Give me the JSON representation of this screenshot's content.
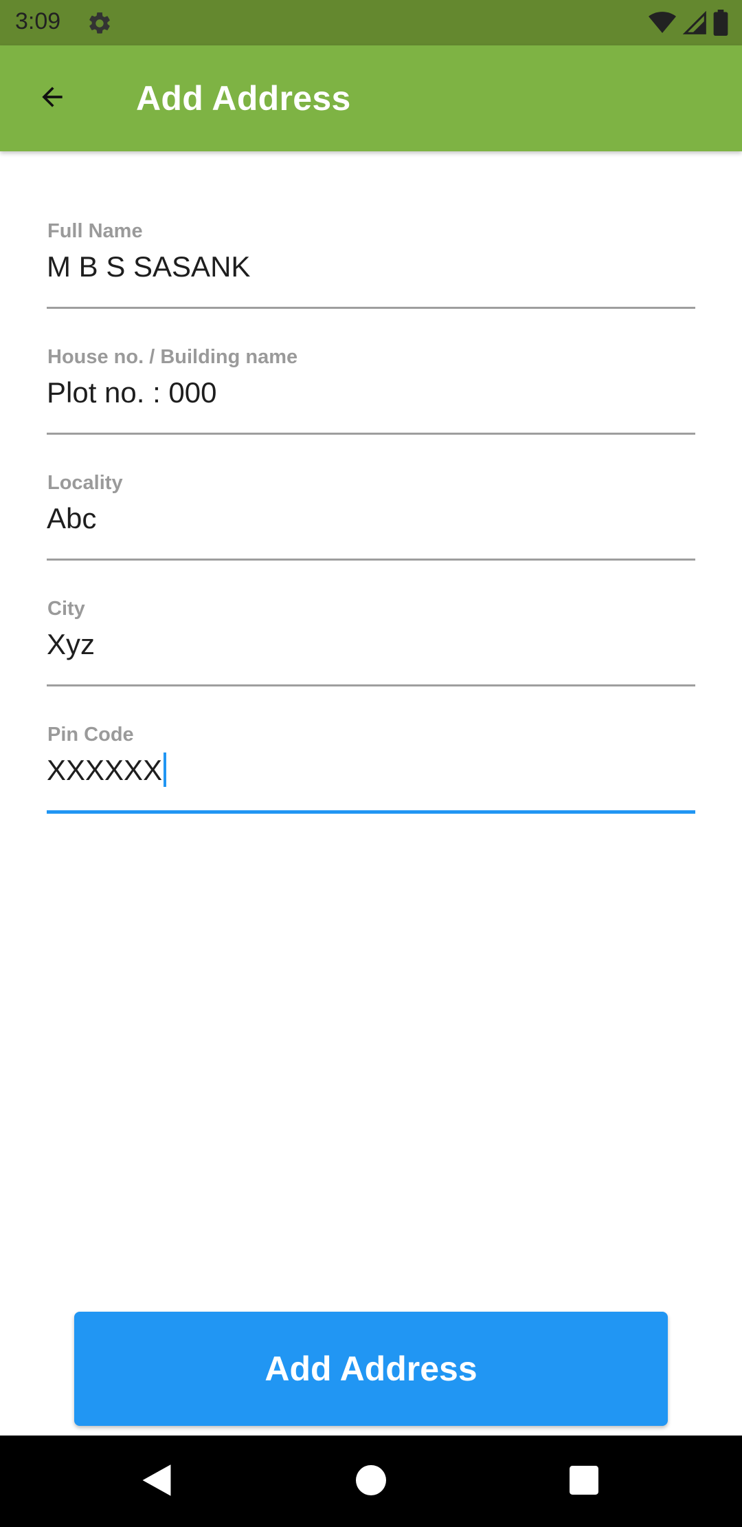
{
  "status_bar": {
    "time": "3:09",
    "icons": [
      "gear-icon",
      "wifi-icon",
      "cell-signal-icon",
      "battery-icon"
    ]
  },
  "app_bar": {
    "title": "Add Address",
    "back_icon": "arrow-left-icon"
  },
  "form": {
    "fields": [
      {
        "label": "Full Name",
        "value": "M B S SASANK"
      },
      {
        "label": "House no. / Building name",
        "value": "Plot no. : 000"
      },
      {
        "label": "Locality",
        "value": "Abc"
      },
      {
        "label": "City",
        "value": "Xyz"
      },
      {
        "label": "Pin Code",
        "value": "XXXXXX"
      }
    ],
    "focused_field": "Pin Code"
  },
  "submit_button": {
    "label": "Add Address"
  },
  "nav_bar": {
    "icons": [
      "nav-back-icon",
      "nav-home-icon",
      "nav-recents-icon"
    ]
  },
  "colors": {
    "status_bar": "#64882f",
    "app_bar": "#7eb344",
    "accent": "#2196f3",
    "label": "#9a9a9a",
    "underline": "#9e9e9e"
  }
}
